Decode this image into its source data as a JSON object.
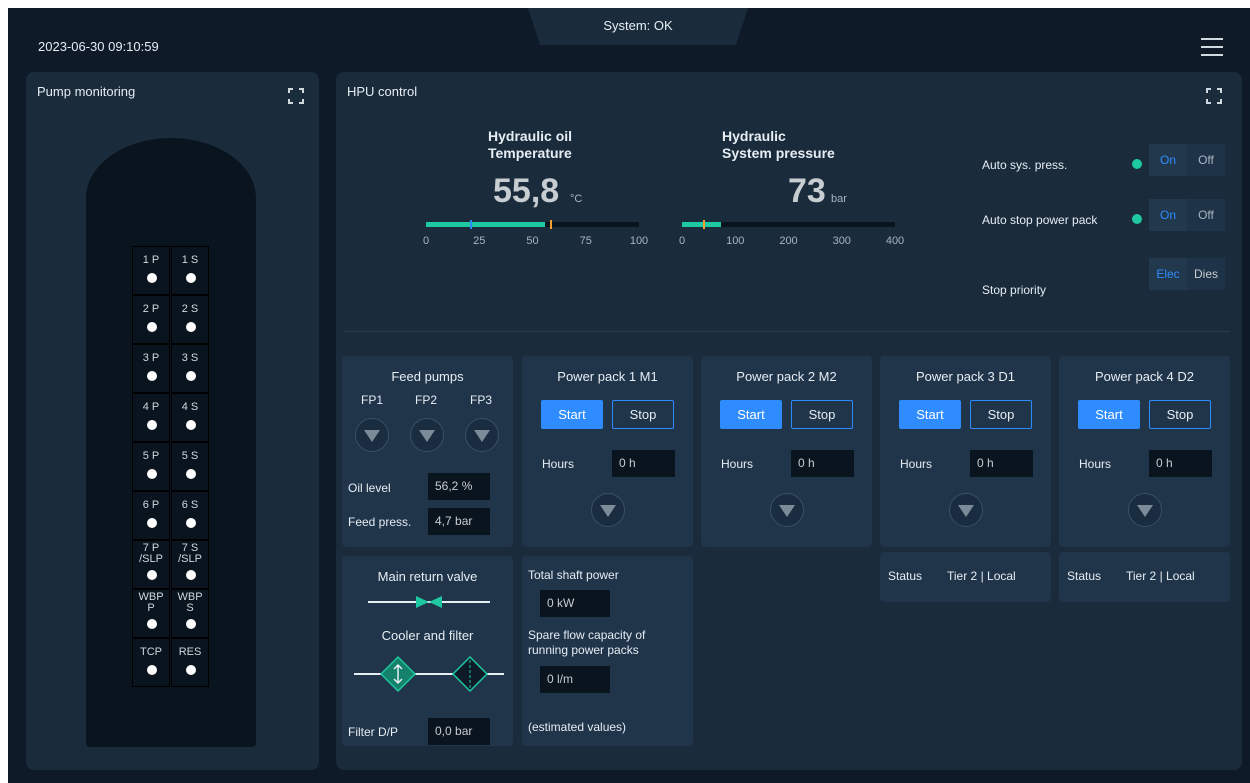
{
  "header": {
    "datetime": "2023-06-30 09:10:59",
    "system_status": "System: OK"
  },
  "pump_monitoring": {
    "title": "Pump monitoring",
    "pumps": [
      {
        "label": "1 P"
      },
      {
        "label": "1 S"
      },
      {
        "label": "2 P"
      },
      {
        "label": "2 S"
      },
      {
        "label": "3 P"
      },
      {
        "label": "3 S"
      },
      {
        "label": "4 P"
      },
      {
        "label": "4 S"
      },
      {
        "label": "5 P"
      },
      {
        "label": "5 S"
      },
      {
        "label": "6 P"
      },
      {
        "label": "6 S"
      },
      {
        "label": "7 P\n/SLP"
      },
      {
        "label": "7 S\n/SLP"
      },
      {
        "label": "WBP\nP"
      },
      {
        "label": "WBP\nS"
      },
      {
        "label": "TCP"
      },
      {
        "label": "RES"
      }
    ]
  },
  "hpu": {
    "title": "HPU control",
    "oil_temp": {
      "title": "Hydraulic oil\nTemperature",
      "value": "55,8",
      "unit": "°C",
      "fraction": 0.558,
      "ticks": [
        "0",
        "25",
        "50",
        "75",
        "100"
      ]
    },
    "sys_press": {
      "title": "Hydraulic\nSystem pressure",
      "value": "73",
      "unit": "bar",
      "fraction": 0.1825,
      "ticks": [
        "0",
        "100",
        "200",
        "300",
        "400"
      ]
    },
    "auto_sys_press": {
      "label": "Auto sys. press.",
      "on": "On",
      "off": "Off"
    },
    "auto_stop": {
      "label": "Auto stop power pack",
      "on": "On",
      "off": "Off"
    },
    "stop_priority": {
      "label": "Stop priority",
      "a": "Elec",
      "b": "Dies"
    }
  },
  "feed_pumps": {
    "title": "Feed pumps",
    "pumps": [
      "FP1",
      "FP2",
      "FP3"
    ],
    "oil_level_label": "Oil level",
    "oil_level": "56,2 %",
    "feed_press_label": "Feed press.",
    "feed_press": "4,7 bar"
  },
  "power_packs": [
    {
      "title": "Power pack 1 M1",
      "start": "Start",
      "stop": "Stop",
      "hours_label": "Hours",
      "hours": "0 h"
    },
    {
      "title": "Power pack 2 M2",
      "start": "Start",
      "stop": "Stop",
      "hours_label": "Hours",
      "hours": "0 h"
    },
    {
      "title": "Power pack 3 D1",
      "start": "Start",
      "stop": "Stop",
      "hours_label": "Hours",
      "hours": "0 h",
      "status_label": "Status",
      "status": "Tier 2 | Local"
    },
    {
      "title": "Power pack 4 D2",
      "start": "Start",
      "stop": "Stop",
      "hours_label": "Hours",
      "hours": "0 h",
      "status_label": "Status",
      "status": "Tier 2 | Local"
    }
  ],
  "return_valve": {
    "title": "Main return valve",
    "cooler_label": "Cooler and filter",
    "filter_dp_label": "Filter D/P",
    "filter_dp": "0,0 bar"
  },
  "shaft": {
    "title": "Total shaft power",
    "power": "0 kW",
    "spare_label": "Spare flow capacity of\nrunning power packs",
    "spare": "0 l/m",
    "note": "(estimated values)"
  },
  "colors": {
    "accent": "#2f8cff",
    "ok": "#1ec8a0",
    "panel": "#1a2b3c",
    "background": "#0e1a27"
  }
}
